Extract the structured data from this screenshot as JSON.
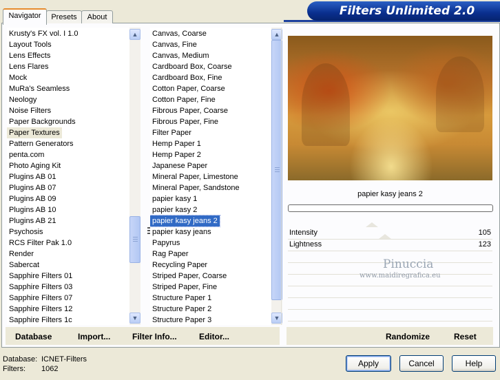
{
  "app": {
    "title": "Filters Unlimited 2.0",
    "colors": {
      "brand": "#0a2f8e",
      "selection": "#316ac5",
      "tab_accent": "#e68b2c"
    }
  },
  "tabs": [
    {
      "label": "Navigator",
      "active": true
    },
    {
      "label": "Presets",
      "active": false
    },
    {
      "label": "About",
      "active": false
    }
  ],
  "categories": {
    "selected": "Paper Textures",
    "items": [
      "Krusty's FX vol. I 1.0",
      "Layout Tools",
      "Lens Effects",
      "Lens Flares",
      "Mock",
      "MuRa's Seamless",
      "Neology",
      "Noise Filters",
      "Paper Backgrounds",
      "Paper Textures",
      "Pattern Generators",
      "penta.com",
      "Photo Aging Kit",
      "Plugins AB 01",
      "Plugins AB 07",
      "Plugins AB 09",
      "Plugins AB 10",
      "Plugins AB 21",
      "Psychosis",
      "RCS Filter Pak 1.0",
      "Render",
      "Sabercat",
      "Sapphire Filters 01",
      "Sapphire Filters 03",
      "Sapphire Filters 07",
      "Sapphire Filters 12",
      "Sapphire Filters 1c"
    ]
  },
  "filters": {
    "selected": "papier kasy jeans 2",
    "items": [
      "Canvas, Coarse",
      "Canvas, Fine",
      "Canvas, Medium",
      "Cardboard Box, Coarse",
      "Cardboard Box, Fine",
      "Cotton Paper, Coarse",
      "Cotton Paper, Fine",
      "Fibrous Paper, Coarse",
      "Fibrous Paper, Fine",
      "Filter Paper",
      "Hemp Paper 1",
      "Hemp Paper 2",
      "Japanese Paper",
      "Mineral Paper, Limestone",
      "Mineral Paper, Sandstone",
      "papier kasy 1",
      "papier kasy 2",
      "papier kasy jeans 2",
      "papier kasy jeans",
      "Papyrus",
      "Rag Paper",
      "Recycling Paper",
      "Striped Paper, Coarse",
      "Striped Paper, Fine",
      "Structure Paper 1",
      "Structure Paper 2",
      "Structure Paper 3"
    ]
  },
  "preview": {
    "name": "papier kasy jeans 2"
  },
  "sliders": [
    {
      "name": "Intensity",
      "value": "105"
    },
    {
      "name": "Lightness",
      "value": "123"
    }
  ],
  "watermark": {
    "name": "Pinuccia",
    "site": "www.maidiregrafica.eu"
  },
  "toolbar_left": {
    "database": "Database",
    "import": "Import...",
    "filter_info": "Filter Info...",
    "editor": "Editor..."
  },
  "toolbar_right": {
    "randomize": "Randomize",
    "reset": "Reset"
  },
  "status": {
    "database_label": "Database:",
    "database_value": "ICNET-Filters",
    "filters_label": "Filters:",
    "filters_value": "1062"
  },
  "buttons": {
    "apply": "Apply",
    "cancel": "Cancel",
    "help": "Help"
  }
}
